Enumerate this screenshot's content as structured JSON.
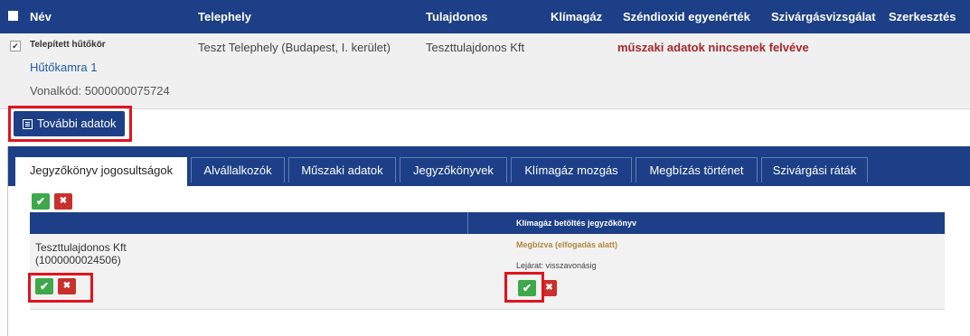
{
  "header": {
    "columns": [
      "Név",
      "Telephely",
      "Tulajdonos",
      "Klímagáz",
      "Széndioxid egyenérték",
      "Szivárgásvizsgálat",
      "Szerkesztés"
    ]
  },
  "record": {
    "type_label": "Telepített hűtőkör",
    "name_link": "Hűtőkamra 1",
    "barcode": "Vonalkód: 5000000075724",
    "site": "Teszt Telephely (Budapest, I. kerület)",
    "owner": "Teszttulajdonos Kft",
    "warning": "műszaki adatok nincsenek felvéve"
  },
  "more_button": {
    "label": "További adatok"
  },
  "tabs": [
    {
      "label": "Jegyzőkönyv jogosultságok",
      "active": true
    },
    {
      "label": "Alvállalkozók",
      "active": false
    },
    {
      "label": "Műszaki adatok",
      "active": false
    },
    {
      "label": "Jegyzőkönyvek",
      "active": false
    },
    {
      "label": "Klímagáz mozgás",
      "active": false
    },
    {
      "label": "Megbízás történet",
      "active": false
    },
    {
      "label": "Szivárgási ráták",
      "active": false
    }
  ],
  "permissions": {
    "column_header": "Klímagáz betöltés jegyzőkönyv",
    "owner_name": "Teszttulajdonos Kft",
    "owner_id": "(1000000024506)",
    "status": "Megbízva (elfogadás alatt)",
    "expiry": "Lejárat: visszavonásig"
  },
  "icons": {
    "accept": "✔",
    "reject": "✖",
    "checkbox": "✔"
  },
  "colors": {
    "primary": "#1c3f87",
    "accept": "#3ea84b",
    "reject": "#c9302c",
    "highlight": "#e0141e",
    "warning": "#a8262e",
    "status": "#b1873c"
  }
}
